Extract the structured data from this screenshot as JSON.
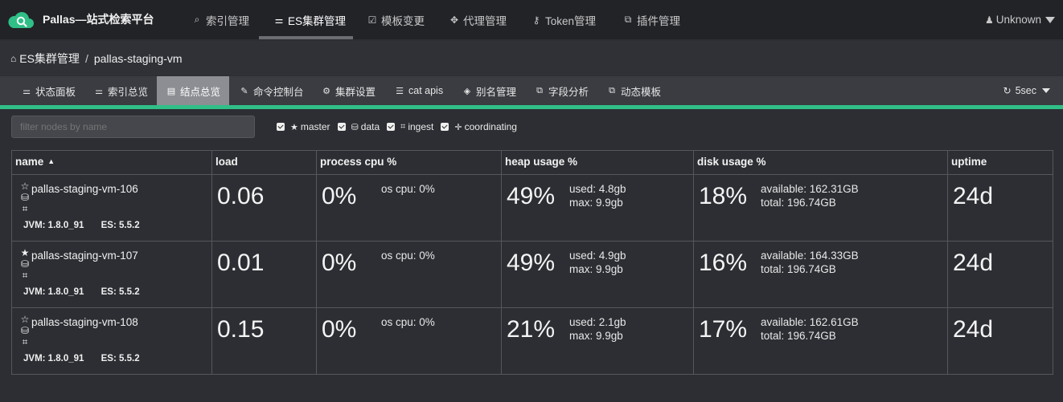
{
  "brand": {
    "name": "Pallas—站式检索平台",
    "accent": "#2fbf87"
  },
  "nav": [
    {
      "icon": "search-icon",
      "glyph": "⌕",
      "label": "索引管理"
    },
    {
      "icon": "sitemap-icon",
      "glyph": "⚌",
      "label": "ES集群管理"
    },
    {
      "icon": "checkbox-edit-icon",
      "glyph": "☑",
      "label": "模板变更"
    },
    {
      "icon": "arrows-move-icon",
      "glyph": "✥",
      "label": "代理管理"
    },
    {
      "icon": "key-icon",
      "glyph": "⚷",
      "label": "Token管理"
    },
    {
      "icon": "puzzle-icon",
      "glyph": "⧉",
      "label": "插件管理"
    }
  ],
  "user": {
    "label": "Unknown"
  },
  "breadcrumb": {
    "root": "ES集群管理",
    "separator": "/",
    "current": "pallas-staging-vm"
  },
  "tabs": [
    {
      "icon": "sitemap-icon",
      "glyph": "⚌",
      "label": "状态面板"
    },
    {
      "icon": "sitemap-icon",
      "glyph": "⚌",
      "label": "索引总览"
    },
    {
      "icon": "table-icon",
      "glyph": "▤",
      "label": "结点总览"
    },
    {
      "icon": "edit-icon",
      "glyph": "✎",
      "label": "命令控制台"
    },
    {
      "icon": "cogs-icon",
      "glyph": "⚙",
      "label": "集群设置"
    },
    {
      "icon": "list-icon",
      "glyph": "☰",
      "label": "cat apis"
    },
    {
      "icon": "tags-icon",
      "glyph": "◈",
      "label": "别名管理"
    },
    {
      "icon": "puzzle-icon",
      "glyph": "⧉",
      "label": "字段分析"
    },
    {
      "icon": "puzzle-icon",
      "glyph": "⧉",
      "label": "动态模板"
    }
  ],
  "refresh": {
    "label": "5sec"
  },
  "filter": {
    "placeholder": "filter nodes by name"
  },
  "roles": [
    {
      "icon": "star-icon",
      "glyph": "★",
      "label": "master"
    },
    {
      "icon": "hdd-icon",
      "glyph": "⛁",
      "label": "data"
    },
    {
      "icon": "crop-icon",
      "glyph": "⌗",
      "label": "ingest"
    },
    {
      "icon": "crosshairs-icon",
      "glyph": "✛",
      "label": "coordinating"
    }
  ],
  "table": {
    "headers": [
      "name",
      "load",
      "process cpu %",
      "heap usage %",
      "disk usage %",
      "uptime"
    ],
    "rows": [
      {
        "name": "pallas-staging-vm-106",
        "master": "☆",
        "jvm": "JVM: 1.8.0_91",
        "es": "ES: 5.5.2",
        "load": "0.06",
        "cpu": "0%",
        "os_cpu": "os cpu: 0%",
        "heap": "49%",
        "heap_used": "used: 4.8gb",
        "heap_max": "max: 9.9gb",
        "disk": "18%",
        "disk_avail": "available: 162.31GB",
        "disk_total": "total: 196.74GB",
        "uptime": "24d"
      },
      {
        "name": "pallas-staging-vm-107",
        "master": "★",
        "jvm": "JVM: 1.8.0_91",
        "es": "ES: 5.5.2",
        "load": "0.01",
        "cpu": "0%",
        "os_cpu": "os cpu: 0%",
        "heap": "49%",
        "heap_used": "used: 4.9gb",
        "heap_max": "max: 9.9gb",
        "disk": "16%",
        "disk_avail": "available: 164.33GB",
        "disk_total": "total: 196.74GB",
        "uptime": "24d"
      },
      {
        "name": "pallas-staging-vm-108",
        "master": "☆",
        "jvm": "JVM: 1.8.0_91",
        "es": "ES: 5.5.2",
        "load": "0.15",
        "cpu": "0%",
        "os_cpu": "os cpu: 0%",
        "heap": "21%",
        "heap_used": "used: 2.1gb",
        "heap_max": "max: 9.9gb",
        "disk": "17%",
        "disk_avail": "available: 162.61GB",
        "disk_total": "total: 196.74GB",
        "uptime": "24d"
      }
    ]
  }
}
